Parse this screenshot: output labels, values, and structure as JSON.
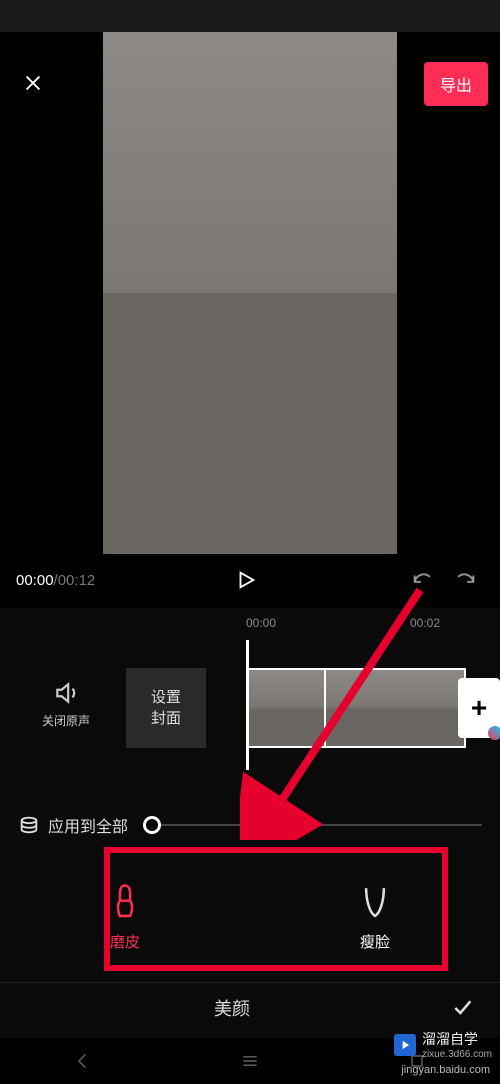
{
  "header": {
    "export_label": "导出"
  },
  "playback": {
    "current": "00:00",
    "total": "00:12"
  },
  "timeline": {
    "tick1": "00:00",
    "tick2": "00:02",
    "audio_label": "关闭原声",
    "cover_line1": "设置",
    "cover_line2": "封面"
  },
  "slider": {
    "apply_all": "应用到全部"
  },
  "beauty": {
    "opt1": "磨皮",
    "opt2": "瘦脸",
    "title": "美颜"
  },
  "watermark": {
    "brand": "溜溜自学",
    "sub1": "zixue.3d66.com",
    "sub2": "jingyan.baidu.com"
  }
}
